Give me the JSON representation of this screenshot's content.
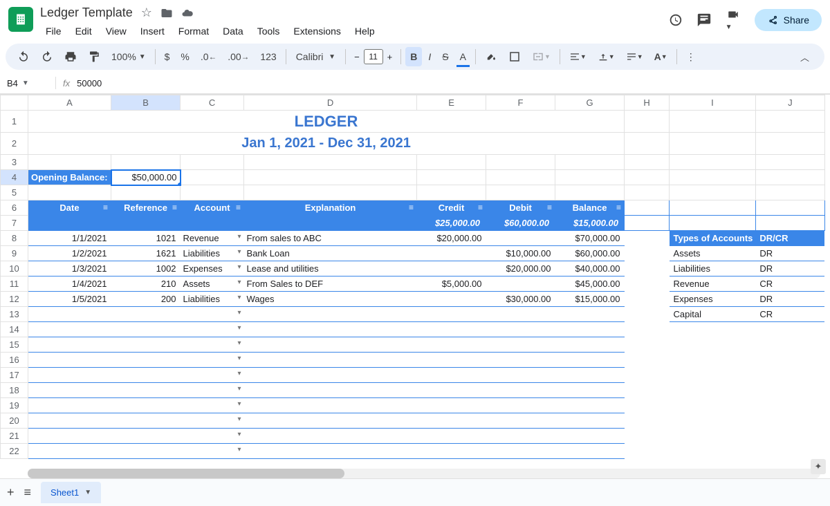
{
  "doc": {
    "name": "Ledger Template"
  },
  "menus": [
    "File",
    "Edit",
    "View",
    "Insert",
    "Format",
    "Data",
    "Tools",
    "Extensions",
    "Help"
  ],
  "share": "Share",
  "toolbar": {
    "zoom": "100%",
    "font": "Calibri",
    "size": "11",
    "numfmt": "123"
  },
  "cellref": "B4",
  "fxval": "50000",
  "cols": [
    "A",
    "B",
    "C",
    "D",
    "E",
    "F",
    "G",
    "H",
    "I",
    "J"
  ],
  "ledger": {
    "title": "LEDGER",
    "subtitle": "Jan 1, 2021 - Dec 31, 2021",
    "ob_label": "Opening Balance:",
    "ob_value": "$50,000.00",
    "headers": [
      "Date",
      "Reference",
      "Account",
      "Explanation",
      "Credit",
      "Debit",
      "Balance"
    ],
    "totals": {
      "credit": "$25,000.00",
      "debit": "$60,000.00",
      "balance": "$15,000.00"
    },
    "rows": [
      {
        "date": "1/1/2021",
        "ref": "1021",
        "acct": "Revenue",
        "exp": "From sales to ABC",
        "credit": "$20,000.00",
        "debit": "",
        "bal": "$70,000.00"
      },
      {
        "date": "1/2/2021",
        "ref": "1621",
        "acct": "Liabilities",
        "exp": "Bank Loan",
        "credit": "",
        "debit": "$10,000.00",
        "bal": "$60,000.00"
      },
      {
        "date": "1/3/2021",
        "ref": "1002",
        "acct": "Expenses",
        "exp": "Lease and utilities",
        "credit": "",
        "debit": "$20,000.00",
        "bal": "$40,000.00"
      },
      {
        "date": "1/4/2021",
        "ref": "210",
        "acct": "Assets",
        "exp": "From Sales to DEF",
        "credit": "$5,000.00",
        "debit": "",
        "bal": "$45,000.00"
      },
      {
        "date": "1/5/2021",
        "ref": "200",
        "acct": "Liabilities",
        "exp": "Wages",
        "credit": "",
        "debit": "$30,000.00",
        "bal": "$15,000.00"
      }
    ]
  },
  "side": {
    "h1": "Types of Accounts",
    "h2": "DR/CR",
    "rows": [
      {
        "t": "Assets",
        "v": "DR"
      },
      {
        "t": "Liabilities",
        "v": "DR"
      },
      {
        "t": "Revenue",
        "v": "CR"
      },
      {
        "t": "Expenses",
        "v": "DR"
      },
      {
        "t": "Capital",
        "v": "CR"
      }
    ]
  },
  "sheet": "Sheet1"
}
